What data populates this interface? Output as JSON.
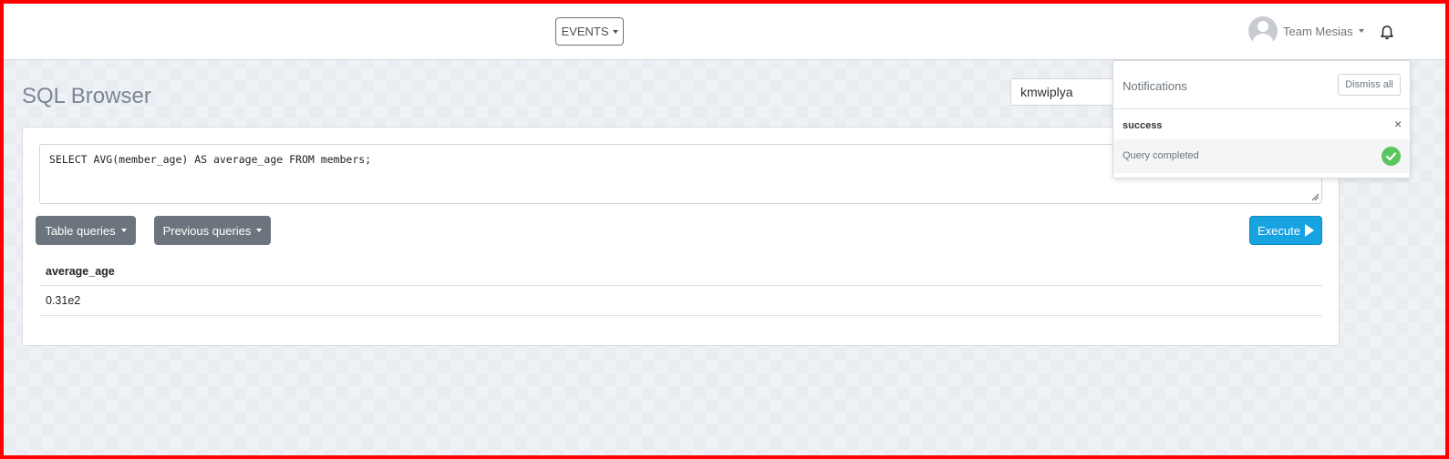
{
  "nav": {
    "events_label": "EVENTS",
    "user_name": "Team Mesias"
  },
  "page": {
    "title": "SQL Browser",
    "database": "kmwiplya"
  },
  "editor": {
    "query": "SELECT AVG(member_age) AS average_age FROM members;"
  },
  "buttons": {
    "table_queries": "Table queries",
    "previous_queries": "Previous queries",
    "execute": "Execute"
  },
  "results": {
    "columns": [
      "average_age"
    ],
    "rows": [
      [
        "0.31e2"
      ]
    ]
  },
  "notifications": {
    "title": "Notifications",
    "dismiss_all": "Dismiss all",
    "items": [
      {
        "type": "success",
        "message": "Query completed",
        "close": "×"
      }
    ]
  },
  "colors": {
    "execute": "#17a2e0",
    "secondary": "#6c757d",
    "success": "#5cc65e"
  }
}
